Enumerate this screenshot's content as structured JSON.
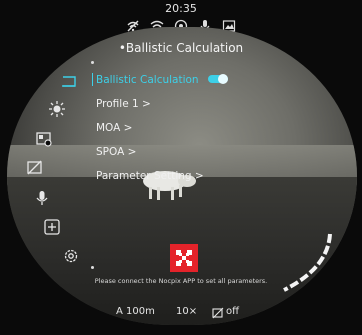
{
  "status": {
    "time": "20:35",
    "icons": [
      "wifi-off-icon",
      "wifi-icon",
      "compass-icon",
      "microphone-icon",
      "image-icon"
    ]
  },
  "panel": {
    "title": "•Ballistic Calculation",
    "items": [
      {
        "label": "Ballistic Calculation",
        "selected": true,
        "toggle_on": true
      },
      {
        "label": "Profile 1 >"
      },
      {
        "label": "MOA >"
      },
      {
        "label": "SPOA >"
      },
      {
        "label": "Parameter Setting >"
      }
    ]
  },
  "sidebar": {
    "icons": [
      "menu-return-icon",
      "brightness-icon",
      "gallery-icon",
      "screen-off-icon",
      "microphone-icon",
      "add-icon",
      "settings-icon"
    ]
  },
  "notice": "Please connect the Nocpix APP to set all parameters.",
  "bottom": {
    "mode": "A 100m",
    "zoom": "10×",
    "display_state": "off"
  },
  "colors": {
    "accent": "#3dd0e8",
    "qr": "#e4232a"
  }
}
